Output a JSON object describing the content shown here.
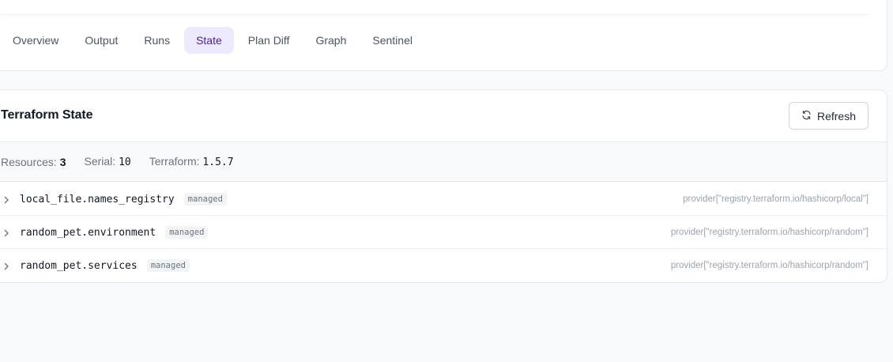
{
  "tabs": [
    {
      "label": "Overview",
      "active": false
    },
    {
      "label": "Output",
      "active": false
    },
    {
      "label": "Runs",
      "active": false
    },
    {
      "label": "State",
      "active": true
    },
    {
      "label": "Plan Diff",
      "active": false
    },
    {
      "label": "Graph",
      "active": false
    },
    {
      "label": "Sentinel",
      "active": false
    }
  ],
  "state": {
    "title": "Terraform State",
    "refresh_label": "Refresh",
    "meta": {
      "resources_label": "Resources:",
      "resources_value": "3",
      "serial_label": "Serial:",
      "serial_value": "10",
      "terraform_label": "Terraform:",
      "terraform_value": "1.5.7"
    },
    "resources": [
      {
        "name": "local_file.names_registry",
        "mode": "managed",
        "provider": "provider[\"registry.terraform.io/hashicorp/local\"]"
      },
      {
        "name": "random_pet.environment",
        "mode": "managed",
        "provider": "provider[\"registry.terraform.io/hashicorp/random\"]"
      },
      {
        "name": "random_pet.services",
        "mode": "managed",
        "provider": "provider[\"registry.terraform.io/hashicorp/random\"]"
      }
    ]
  },
  "colors": {
    "accent_bg": "#ede9fe",
    "accent_text": "#4c1d95",
    "border": "#e5e7eb",
    "page_bg": "#f9fafb"
  }
}
